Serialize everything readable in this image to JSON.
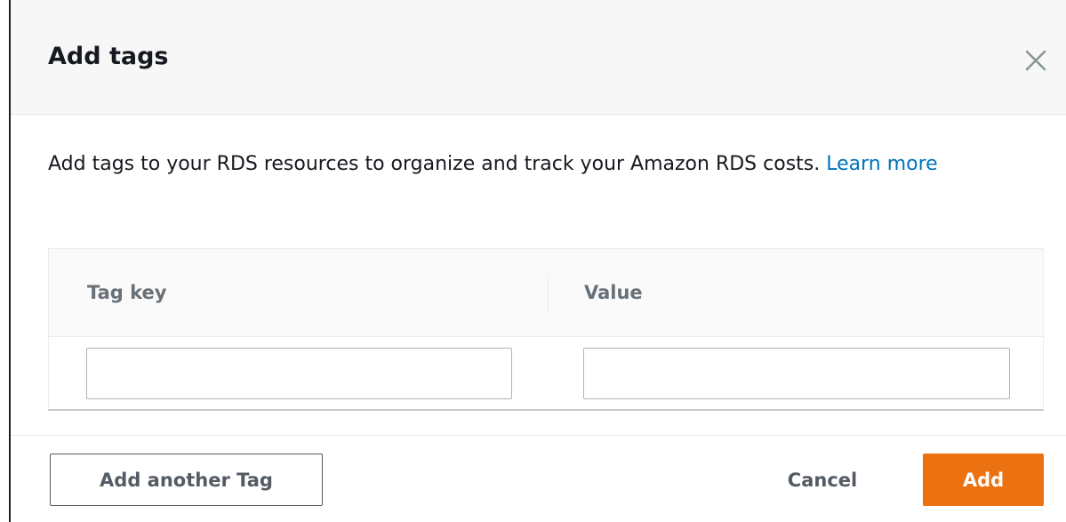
{
  "dialog": {
    "title": "Add tags",
    "close_icon": "close-icon",
    "description": "Add tags to your RDS resources to organize and track your Amazon RDS costs.",
    "learn_more_label": "Learn more"
  },
  "table": {
    "columns": {
      "key": "Tag key",
      "value": "Value"
    },
    "row": {
      "key_value": "",
      "value_value": ""
    }
  },
  "footer": {
    "add_another_label": "Add another Tag",
    "cancel_label": "Cancel",
    "add_label": "Add"
  },
  "colors": {
    "primary": "#ec7211",
    "link": "#0073bb",
    "muted_text": "#687078"
  }
}
